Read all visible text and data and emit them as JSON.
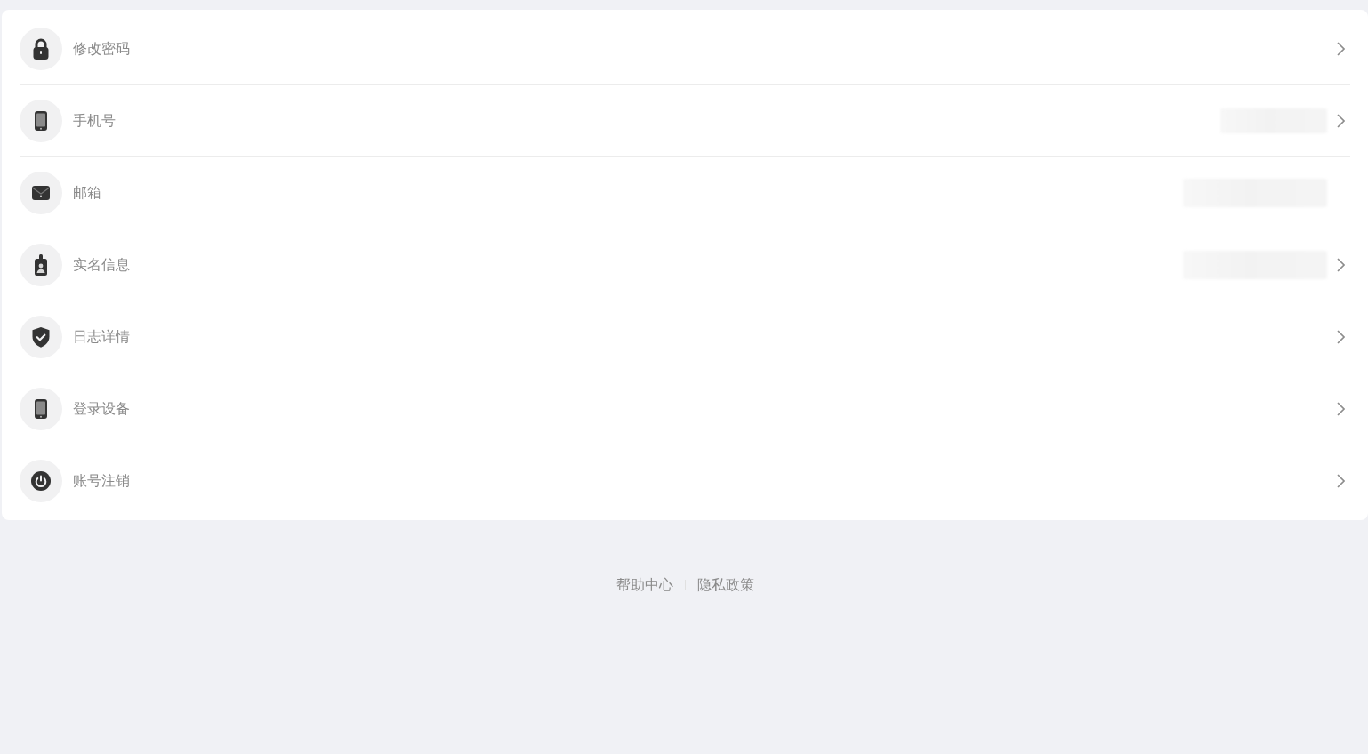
{
  "settings": {
    "rows": [
      {
        "label": "修改密码",
        "value_hidden": false,
        "has_arrow": true
      },
      {
        "label": "手机号",
        "value_hidden": true,
        "has_arrow": true
      },
      {
        "label": "邮箱",
        "value_hidden": true,
        "has_arrow": false
      },
      {
        "label": "实名信息",
        "value_hidden": true,
        "has_arrow": true
      },
      {
        "label": "日志详情",
        "value_hidden": false,
        "has_arrow": true
      },
      {
        "label": "登录设备",
        "value_hidden": false,
        "has_arrow": true
      },
      {
        "label": "账号注销",
        "value_hidden": false,
        "has_arrow": true
      }
    ]
  },
  "footer": {
    "links": [
      "帮助中心",
      "隐私政策"
    ]
  }
}
